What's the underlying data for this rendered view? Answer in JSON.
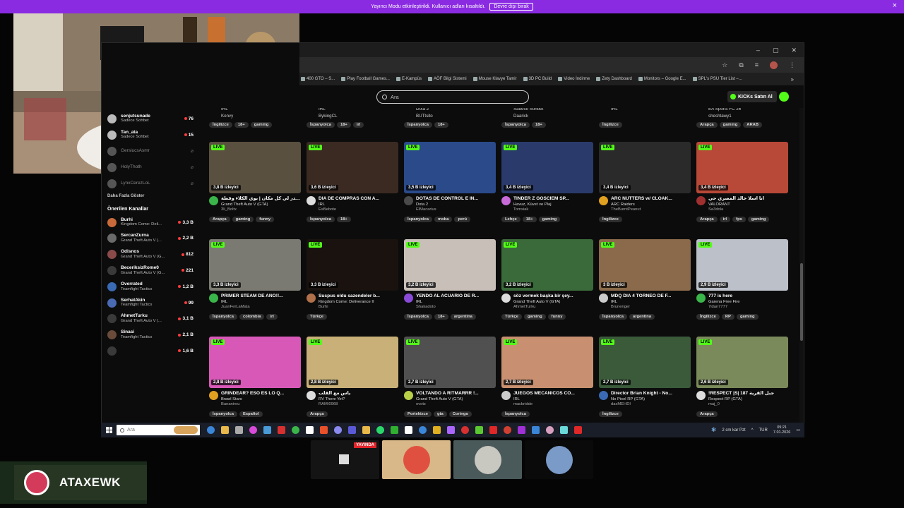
{
  "banner": {
    "message": "Yayıncı Modu etkinleştirildi. Kullanıcı adları kısaltıldı.",
    "button": "Devre dışı bırak",
    "close": "×"
  },
  "window": {
    "minimize": "–",
    "maximize": "▢",
    "close": "✕"
  },
  "urlbar_icons": {
    "star": "☆",
    "ext": "⧉",
    "menu": "⋮",
    "profile_bar": "≡"
  },
  "bookmarks": [
    "400 GTO – S...",
    "Play Football Games...",
    "E-Kampüs",
    "AÖF Bilgi Sistemi",
    "Mouse Klavye Tamir",
    "3D PC Build",
    "Video İndirme",
    "Zety Dashboard",
    "Monitors – Google E...",
    "SPL's PSU Tier List –..."
  ],
  "bookmarks_more": "»",
  "search": {
    "placeholder": "Ara"
  },
  "buy_ai": "KICKs Satın Al",
  "sidebar": {
    "followed": [
      {
        "name": "senjutsunade",
        "category": "Sadece Sohbet",
        "viewers": "76",
        "online": true
      },
      {
        "name": "Tan_ata",
        "category": "Sadece Sohbet",
        "viewers": "15",
        "online": true
      },
      {
        "name": "GersiucsAsmr",
        "online": false
      },
      {
        "name": "HolyThoth",
        "online": false
      },
      {
        "name": "LynxCerezLoL",
        "online": false
      }
    ],
    "show_more": "Daha Fazla Göster",
    "recommended_title": "Önerilen Kanallar",
    "recommended": [
      {
        "name": "Burhi",
        "category": "Kingdom Come: Deli...",
        "viewers": "3,3 B"
      },
      {
        "name": "SercanZurna",
        "category": "Grand Theft Auto V (...",
        "viewers": "2,2 B"
      },
      {
        "name": "Odisnos",
        "category": "Grand Theft Auto V (G...",
        "viewers": "812"
      },
      {
        "name": "BeceriksizRome0",
        "category": "Grand Theft Auto V (G...",
        "viewers": "221"
      },
      {
        "name": "Overrated",
        "category": "Teamfight Tactics",
        "viewers": "1,2 B"
      },
      {
        "name": "SerhatAkin",
        "category": "Teamfight Tactics",
        "viewers": "99"
      },
      {
        "name": "AhmetTurku",
        "category": "Grand Theft Auto V (...",
        "viewers": "3,1 B"
      },
      {
        "name": "Sinasi",
        "category": "Teamfight Tactics",
        "viewers": "2,1 B"
      },
      {
        "name": "",
        "category": "",
        "viewers": "1,6 B"
      }
    ],
    "status_url": "https://kick.com/juanferlamata"
  },
  "toprow": [
    {
      "cat": "IRL",
      "name": "Konvy",
      "tags": [
        "İngilizce",
        "18+",
        "gaming"
      ]
    },
    {
      "cat": "IRL",
      "name": "BykingCL",
      "tags": [
        "İspanyolca",
        "18+",
        "irl"
      ]
    },
    {
      "cat": "Dota 2",
      "name": "BUTtsito",
      "tags": [
        "İspanyolca",
        "18+"
      ]
    },
    {
      "cat": "Sadece Sohbet",
      "name": "Daarick",
      "tags": [
        "İspanyolca",
        "18+"
      ]
    },
    {
      "cat": "IRL",
      "name": "",
      "tags": [
        "İngilizce"
      ]
    },
    {
      "cat": "EA Sports FC 26",
      "name": "sheshtawy1",
      "tags": [
        "Arapça",
        "gaming",
        "ARAB"
      ]
    }
  ],
  "streams": [
    {
      "viewers": "3,8 B izleyici",
      "title": "الحدر لي كل مكان | بوي الكلاء وقطة",
      "category": "Grand Theft Auto V (GTA)",
      "streamer": "3li_Boltx",
      "tags": [
        "Arapça",
        "gaming",
        "funny"
      ]
    },
    {
      "viewers": "3,6 B izleyici",
      "title": "DIA DE COMPRAS CON A...",
      "category": "IRL",
      "streamer": "EsBebote",
      "tags": [
        "İspanyolca",
        "18+"
      ]
    },
    {
      "viewers": "3,5 B izleyici",
      "title": "DOTAS DE CONTROL E IN...",
      "category": "Dota 2",
      "streamer": "ElMacarius",
      "tags": [
        "İspanyolca",
        "moba",
        "perú"
      ]
    },
    {
      "viewers": "3,4 B izleyici",
      "title": "TINDER Z GOŚCIEM SP...",
      "category": "Havuz, Küvet ve Plaj",
      "streamer": "Tomsiak",
      "tags": [
        "Lehçe",
        "18+",
        "gaming"
      ]
    },
    {
      "viewers": "3,4 B izleyici",
      "title": "ARC NUTTERS w/ CLOAK...",
      "category": "ARC Raiders",
      "streamer": "TheBurntPeanut",
      "tags": [
        "İngilizce"
      ]
    },
    {
      "viewers": "3,4 B izleyici",
      "title": "انا اسلا خالد المصري حي",
      "category": "VALORANT",
      "streamer": "Sa3dola",
      "tags": [
        "Arapça",
        "irl",
        "fps",
        "gaming"
      ]
    },
    {
      "viewers": "3,3 B izleyici",
      "title": "PRIMER STEAM DE AÑO!!...",
      "category": "IRL",
      "streamer": "JuanFerLaMata",
      "tags": [
        "İspanyolca",
        "colombia",
        "irl"
      ]
    },
    {
      "viewers": "3,3 B izleyici",
      "title": "Suspus oldu sazendeler b...",
      "category": "Kingdom Come: Deliverance II",
      "streamer": "Burhi",
      "tags": [
        "Türkçe"
      ]
    },
    {
      "viewers": "3,2 B izleyici",
      "title": "YENDO AL ACUARIO DE R...",
      "category": "IRL",
      "streamer": "Shakadoto",
      "tags": [
        "İspanyolca",
        "18+",
        "argentina"
      ]
    },
    {
      "viewers": "3,2 B izleyici",
      "title": "söz vermek başka bir şey...",
      "category": "Grand Theft Auto V (GTA)",
      "streamer": "AhmetTurku",
      "tags": [
        "Türkçe",
        "gaming",
        "funny"
      ]
    },
    {
      "viewers": "3 B izleyici",
      "title": "MDQ DIA 4 TORNEO DE F...",
      "category": "IRL",
      "streamer": "Brunenger",
      "tags": [
        "İspanyolca",
        "argentina"
      ]
    },
    {
      "viewers": "2,9 B izleyici",
      "title": "777 is here",
      "category": "Garena Free Fire",
      "streamer": "7idan7777",
      "tags": [
        "İngilizce",
        "RP",
        "gaming"
      ]
    },
    {
      "viewers": "2,8 B izleyici",
      "title": "GRINDEAR? ESO ES LO Q...",
      "category": "Brawl Stars",
      "streamer": "Bananirou",
      "tags": [
        "İspanyolca",
        "Español"
      ]
    },
    {
      "viewers": "2,8 B izleyici",
      "title": "ياس مع القلب",
      "category": "RV There Yet?",
      "streamer": "RAMI0968",
      "tags": [
        "Arapça"
      ]
    },
    {
      "viewers": "2,7 B izleyici",
      "title": "VOLTANDO A RITMARRR !...",
      "category": "Grand Theft Auto V (GTA)",
      "streamer": "ovotz",
      "tags": [
        "Portekizce",
        "gta",
        "Coringa"
      ]
    },
    {
      "viewers": "2,7 B izleyici",
      "title": "JUEGOS MECANICOS CO...",
      "category": "IRL",
      "streamer": "macbridde",
      "tags": [
        "İspanyolca"
      ]
    },
    {
      "viewers": "2,7 B izleyici",
      "title": "Director Brian Knight - No...",
      "category": "No Pixel RP (GTA)",
      "streamer": "dasMEHDI",
      "tags": [
        "İngilizce"
      ]
    },
    {
      "viewers": "2,6 B izleyici",
      "title": "!RESPECT |S| 187 جبل القرية",
      "category": "Respect RP (GTA)",
      "streamer": "maj_0",
      "tags": [
        "Arapça"
      ]
    }
  ],
  "live_label": "LIVE",
  "thumb_colors": [
    "#5a5040",
    "#3a2a22",
    "#2a4a8a",
    "#2a3a6a",
    "#2a2a2a",
    "#b84838",
    "#7a7a72",
    "#1a120e",
    "#c8c0b8",
    "#3a6a3a",
    "#8a6a4a",
    "#bcc0c8",
    "#d858b8",
    "#c8b078",
    "#505050",
    "#c89070",
    "#3a5a3a",
    "#7a8a5a"
  ],
  "avatar_colors": [
    "#3ab54a",
    "#dddddd",
    "#4a4a4a",
    "#c86ad8",
    "#e0a020",
    "#a03030",
    "#3ab54a",
    "#b0704a",
    "#8a4ad8",
    "#dddddd",
    "#cccccc",
    "#3ab54a",
    "#e0a020",
    "#dddddd",
    "#b8d048",
    "#cccccc",
    "#3a6ab4",
    "#dddddd"
  ],
  "taskbar": {
    "search": "Ara",
    "weather": "2 cm kar Pzt",
    "lang": "TUR",
    "time": "09:21",
    "date": "7.01.2026",
    "icon_colors": [
      "#3a86d8",
      "#e8b84a",
      "#aaaaaa",
      "#d84ad8",
      "#4a9ad8",
      "#d83030",
      "#3ab54a",
      "#ffffff",
      "#e8502a",
      "#8a8af0",
      "#5a5ad8",
      "#e8b84a",
      "#2ad86a",
      "#30b030",
      "#ffffff",
      "#3a86d8",
      "#e0b020",
      "#aa66ff",
      "#d83030",
      "#5ac830",
      "#e02828",
      "#d04030",
      "#a030d8",
      "#3a86d8",
      "#d8a0c0",
      "#6adada",
      "#e02828"
    ]
  },
  "preview_label": "YAYINDA",
  "social": {
    "handle": "ATAXEWK"
  }
}
